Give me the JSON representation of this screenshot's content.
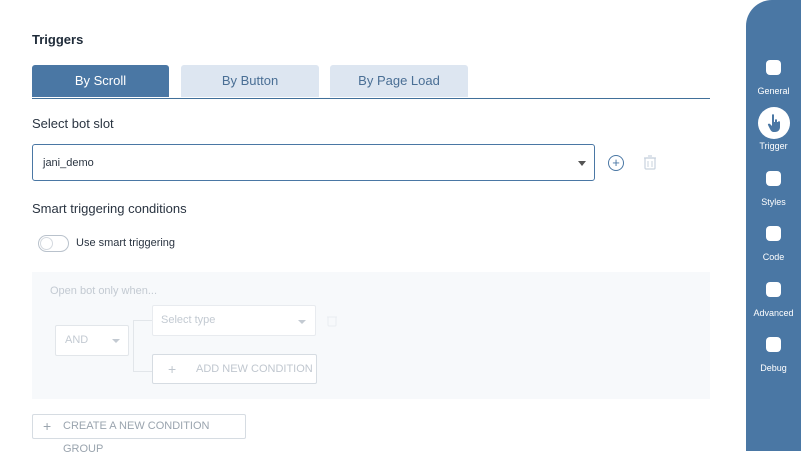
{
  "triggers": {
    "title": "Triggers",
    "tabs": [
      {
        "label": "By Scroll",
        "active": true
      },
      {
        "label": "By Button",
        "active": false
      },
      {
        "label": "By Page Load",
        "active": false
      }
    ]
  },
  "bot_slot": {
    "label": "Select bot slot",
    "value": "jani_demo"
  },
  "smart": {
    "label": "Smart triggering conditions",
    "toggle_label": "Use smart triggering",
    "toggle_on": false,
    "hint": "Open bot only when...",
    "operator": "AND",
    "type_placeholder": "Select type",
    "add_condition": "ADD NEW CONDITION"
  },
  "create_group": "CREATE A NEW CONDITION GROUP",
  "sidebar": {
    "items": [
      {
        "label": "General",
        "icon": "pencil-icon"
      },
      {
        "label": "Trigger",
        "icon": "hand-pointer-icon",
        "selected": true
      },
      {
        "label": "Styles",
        "icon": "brush-icon"
      },
      {
        "label": "Code",
        "icon": "code-icon"
      },
      {
        "label": "Advanced",
        "icon": "advanced-icon"
      },
      {
        "label": "Debug",
        "icon": "terminal-icon"
      }
    ]
  },
  "colors": {
    "accent": "#4a77a4",
    "tab_inactive_bg": "#dde6f1",
    "panel_bg": "#f7f9fb"
  }
}
